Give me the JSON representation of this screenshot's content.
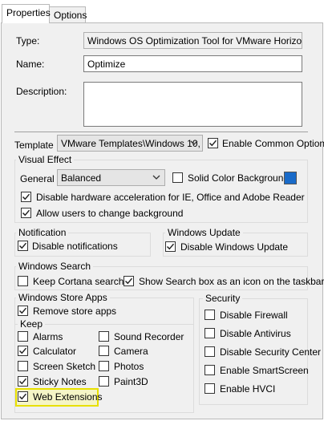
{
  "tabs": [
    "Properties",
    "Options"
  ],
  "type": {
    "label": "Type:",
    "value": "Windows OS Optimization Tool for VMware Horizon"
  },
  "name": {
    "label": "Name:",
    "value": "Optimize"
  },
  "description": {
    "label": "Description:",
    "value": ""
  },
  "template": {
    "label": "Template",
    "value": "VMware Templates\\Windows 10,",
    "common_options_label": "Enable Common Options",
    "common_options_checked": true
  },
  "visual_effect": {
    "title": "Visual Effect",
    "general_label": "General",
    "general_value": "Balanced",
    "solid_color_label": "Solid Color Background",
    "solid_color_checked": false,
    "solid_color_value": "#1a6bc9",
    "hw_accel_label": "Disable hardware acceleration for IE, Office and Adobe Reader",
    "hw_accel_checked": true,
    "allow_bg_label": "Allow users to change background",
    "allow_bg_checked": true
  },
  "notification": {
    "title": "Notification",
    "disable_label": "Disable notifications",
    "disable_checked": true
  },
  "windows_update": {
    "title": "Windows Update",
    "disable_label": "Disable Windows Update",
    "disable_checked": true
  },
  "windows_search": {
    "title": "Windows Search",
    "cortana_label": "Keep Cortana search",
    "cortana_checked": false,
    "searchbox_label": "Show Search box as an icon on the taskbar",
    "searchbox_checked": true
  },
  "store_apps": {
    "title": "Windows Store Apps",
    "remove_label": "Remove store apps",
    "remove_checked": true,
    "keep_label": "Keep",
    "apps": [
      {
        "label": "Alarms",
        "checked": false
      },
      {
        "label": "Sound Recorder",
        "checked": false
      },
      {
        "label": "Calculator",
        "checked": true
      },
      {
        "label": "Camera",
        "checked": false
      },
      {
        "label": "Screen Sketch",
        "checked": false
      },
      {
        "label": "Photos",
        "checked": false
      },
      {
        "label": "Sticky Notes",
        "checked": true
      },
      {
        "label": "Paint3D",
        "checked": false
      },
      {
        "label": "Web Extensions",
        "checked": true
      }
    ]
  },
  "security": {
    "title": "Security",
    "items": [
      {
        "label": "Disable Firewall",
        "checked": false
      },
      {
        "label": "Disable Antivirus",
        "checked": false
      },
      {
        "label": "Disable Security Center",
        "checked": false
      },
      {
        "label": "Enable SmartScreen",
        "checked": false
      },
      {
        "label": "Enable HVCI",
        "checked": false
      }
    ]
  }
}
